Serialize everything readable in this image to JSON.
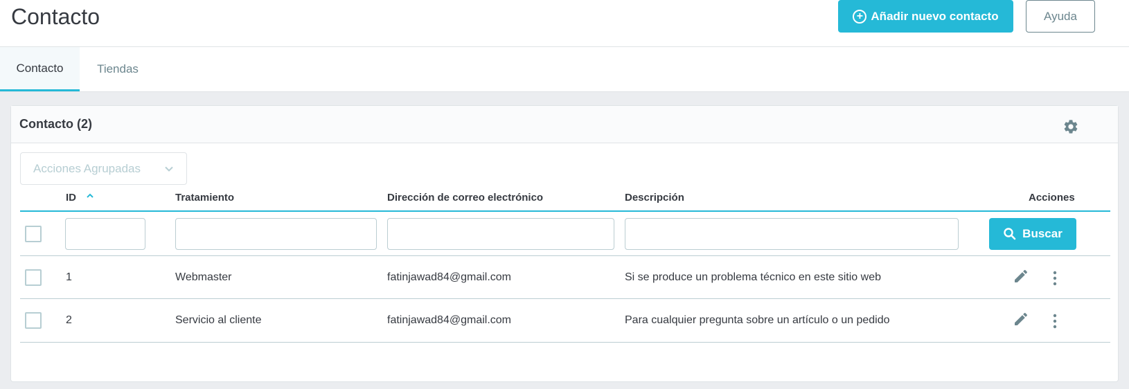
{
  "header": {
    "title": "Contacto",
    "add_button_label": "Añadir nuevo contacto",
    "help_button_label": "Ayuda"
  },
  "tabs": [
    {
      "label": "Contacto",
      "active": true
    },
    {
      "label": "Tiendas",
      "active": false
    }
  ],
  "card": {
    "title": "Contacto (2)",
    "bulk_actions_label": "Acciones Agrupadas",
    "search_button_label": "Buscar"
  },
  "table": {
    "columns": {
      "id": "ID",
      "title": "Tratamiento",
      "email": "Dirección de correo electrónico",
      "description": "Descripción",
      "actions": "Acciones"
    },
    "sort": {
      "column": "id",
      "direction": "asc"
    },
    "rows": [
      {
        "id": "1",
        "title": "Webmaster",
        "email": "fatinjawad84@gmail.com",
        "description": "Si se produce un problema técnico en este sitio web"
      },
      {
        "id": "2",
        "title": "Servicio al cliente",
        "email": "fatinjawad84@gmail.com",
        "description": "Para cualquier pregunta sobre un artículo o un pedido"
      }
    ]
  },
  "colors": {
    "accent": "#25b9d7",
    "text": "#363a41",
    "muted": "#6c868e"
  },
  "icons": [
    "add-circle-icon",
    "gear-icon",
    "chevron-down-icon",
    "sort-asc-icon",
    "search-icon",
    "edit-icon",
    "more-vert-icon"
  ]
}
